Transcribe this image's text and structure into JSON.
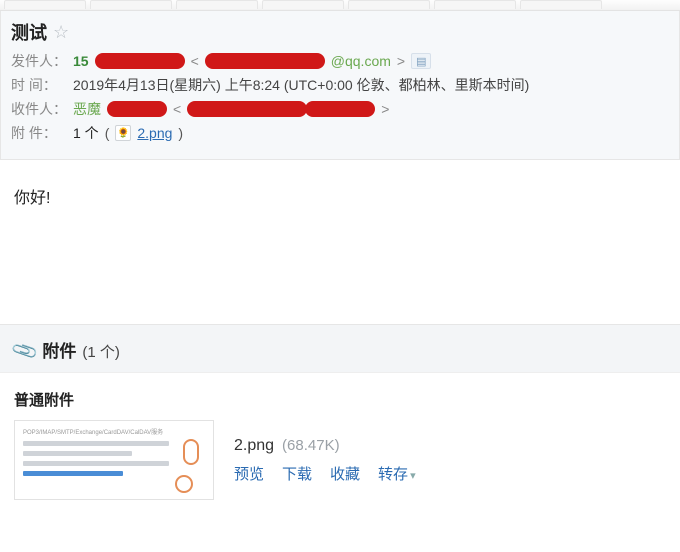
{
  "subject": "测试",
  "meta": {
    "sender_label": "发件人：",
    "sender_name_visible": "15",
    "sender_addr_suffix": "@qq.com",
    "time_label": "时间：",
    "time_label_display": "时   间：",
    "time_value": "2019年4月13日(星期六) 上午8:24 (UTC+0:00 伦敦、都柏林、里斯本时间)",
    "recipient_label": "收件人：",
    "recipient_name_visible": "恶魔",
    "attach_label": "附件：",
    "attach_label_display": "附   件：",
    "attach_count_text": "1 个",
    "attach_inline_name": "2.png"
  },
  "body_text": "你好!",
  "attachments": {
    "panel_title": "附件",
    "panel_count": "(1 个)",
    "section_title": "普通附件",
    "items": [
      {
        "name": "2.png",
        "size": "(68.47K)",
        "actions": {
          "preview": "预览",
          "download": "下载",
          "favorite": "收藏",
          "forward": "转存"
        }
      }
    ]
  },
  "icons": {
    "star": "☆",
    "clip": "📎",
    "flower": "🌻",
    "dropdown": "▾",
    "badge_di": "▤"
  }
}
